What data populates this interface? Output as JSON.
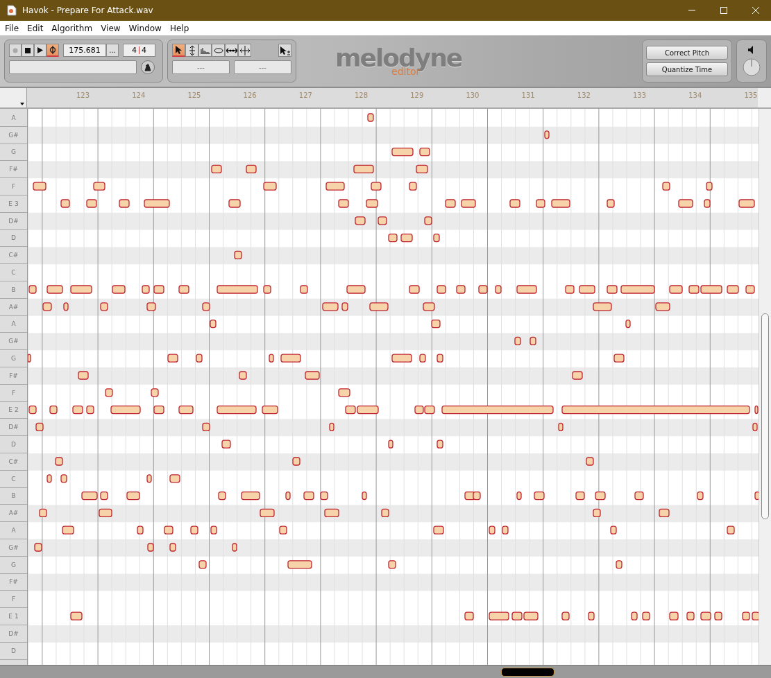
{
  "window": {
    "title": "Havok - Prepare For Attack.wav"
  },
  "menu": [
    "File",
    "Edit",
    "Algorithm",
    "View",
    "Window",
    "Help"
  ],
  "transport": {
    "loop_on": true,
    "tempo": "175.681",
    "tempo_menu": "...",
    "time_signature": {
      "numerator": "4",
      "denominator": "4"
    }
  },
  "tools": [
    {
      "kind": "pointer",
      "selected": true
    },
    {
      "kind": "pitch",
      "selected": false
    },
    {
      "kind": "formant",
      "selected": false
    },
    {
      "kind": "amplitude",
      "selected": false
    },
    {
      "kind": "time",
      "selected": false
    },
    {
      "kind": "split",
      "selected": false
    }
  ],
  "info_fields": [
    "---",
    "---"
  ],
  "logo": {
    "name": "melodyne",
    "edition": "editor"
  },
  "macro_buttons": [
    "Correct Pitch",
    "Quantize Time"
  ],
  "ruler": {
    "bars": [
      "123",
      "124",
      "125",
      "126",
      "127",
      "128",
      "129",
      "130",
      "131",
      "132",
      "133",
      "134",
      "135"
    ]
  },
  "pitch_rows": [
    {
      "label": "A",
      "sharp": false
    },
    {
      "label": "G#",
      "sharp": true
    },
    {
      "label": "G",
      "sharp": false
    },
    {
      "label": "F#",
      "sharp": true
    },
    {
      "label": "F",
      "sharp": false
    },
    {
      "label": "E 3",
      "sharp": false
    },
    {
      "label": "D#",
      "sharp": true
    },
    {
      "label": "D",
      "sharp": false
    },
    {
      "label": "C#",
      "sharp": true
    },
    {
      "label": "C",
      "sharp": false
    },
    {
      "label": "B",
      "sharp": false
    },
    {
      "label": "A#",
      "sharp": true
    },
    {
      "label": "A",
      "sharp": false
    },
    {
      "label": "G#",
      "sharp": true
    },
    {
      "label": "G",
      "sharp": false
    },
    {
      "label": "F#",
      "sharp": true
    },
    {
      "label": "F",
      "sharp": false
    },
    {
      "label": "E 2",
      "sharp": false
    },
    {
      "label": "D#",
      "sharp": true
    },
    {
      "label": "D",
      "sharp": false
    },
    {
      "label": "C#",
      "sharp": true
    },
    {
      "label": "C",
      "sharp": false
    },
    {
      "label": "B",
      "sharp": false
    },
    {
      "label": "A#",
      "sharp": true
    },
    {
      "label": "A",
      "sharp": false
    },
    {
      "label": "G#",
      "sharp": true
    },
    {
      "label": "G",
      "sharp": false
    },
    {
      "label": "F#",
      "sharp": true
    },
    {
      "label": "F",
      "sharp": false
    },
    {
      "label": "E 1",
      "sharp": false
    },
    {
      "label": "D#",
      "sharp": true
    },
    {
      "label": "D",
      "sharp": false
    }
  ]
}
